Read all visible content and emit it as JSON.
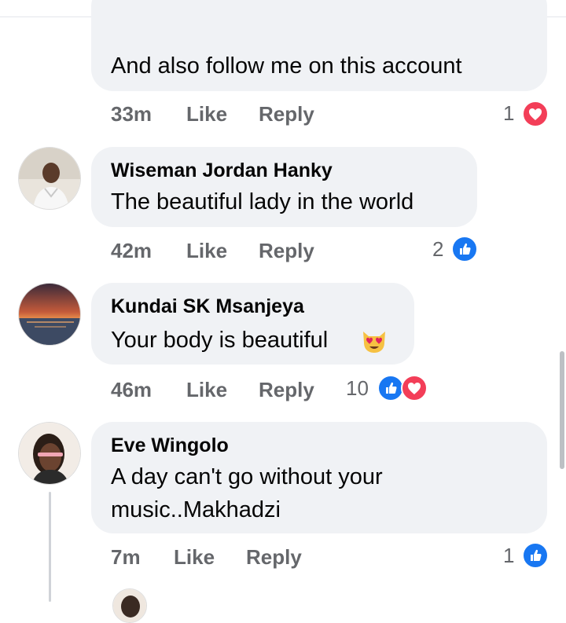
{
  "comments": [
    {
      "text": "And also follow me on this account",
      "time": "33m",
      "like_label": "Like",
      "reply_label": "Reply",
      "reaction_count": "1"
    },
    {
      "author": "Wiseman Jordan Hanky",
      "text": "The beautiful lady in the world",
      "time": "42m",
      "like_label": "Like",
      "reply_label": "Reply",
      "reaction_count": "2"
    },
    {
      "author": "Kundai SK Msanjeya",
      "text": "Your body is beautiful",
      "time": "46m",
      "like_label": "Like",
      "reply_label": "Reply",
      "reaction_count": "10"
    },
    {
      "author": "Eve Wingolo",
      "text_line1": "A day can't go without your",
      "text_line2": "music..Makhadzi",
      "time": "7m",
      "like_label": "Like",
      "reply_label": "Reply",
      "reaction_count": "1"
    }
  ],
  "icons": {
    "like_reaction": "thumbs-up-icon",
    "love_reaction": "heart-icon",
    "emoji": "heart-eyes-cat-emoji"
  },
  "colors": {
    "bubble": "#f0f2f5",
    "meta_text": "#65676b",
    "like_blue": "#1877f2",
    "love_red": "#f33e58"
  }
}
